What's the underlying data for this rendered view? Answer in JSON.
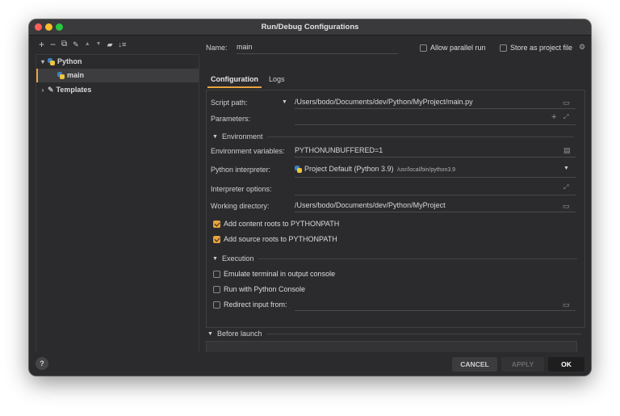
{
  "window": {
    "title": "Run/Debug Configurations",
    "traffic_lights": [
      "#fe5f57",
      "#febc2e",
      "#28c840"
    ]
  },
  "toolbar": {
    "icons": [
      {
        "name": "add-icon",
        "glyph": "+"
      },
      {
        "name": "remove-icon",
        "glyph": "−"
      },
      {
        "name": "copy-icon",
        "glyph": "⧉"
      },
      {
        "name": "wrench-icon",
        "glyph": "🔧"
      },
      {
        "name": "move-up-icon",
        "glyph": "▲"
      },
      {
        "name": "move-down-icon",
        "glyph": "▼"
      },
      {
        "name": "folder-add-icon",
        "glyph": "▰"
      },
      {
        "name": "sort-icon",
        "glyph": "↓"
      }
    ]
  },
  "tree": {
    "python": "Python",
    "main": "main",
    "templates": "Templates"
  },
  "header": {
    "name_label": "Name:",
    "name_value": "main",
    "allow_parallel": "Allow parallel run",
    "store_as_project": "Store as project file"
  },
  "tabs": {
    "configuration": "Configuration",
    "logs": "Logs"
  },
  "form": {
    "script_path_label": "Script path:",
    "script_path_value": "/Users/bodo/Documents/dev/Python/MyProject/main.py",
    "parameters_label": "Parameters:",
    "environment_section": "Environment",
    "env_vars_label": "Environment variables:",
    "env_vars_value": "PYTHONUNBUFFERED=1",
    "interpreter_label": "Python interpreter:",
    "interpreter_value": "Project Default (Python 3.9)",
    "interpreter_path": "/usr/local/bin/python3.9",
    "interpreter_options_label": "Interpreter options:",
    "working_dir_label": "Working directory:",
    "working_dir_value": "/Users/bodo/Documents/dev/Python/MyProject",
    "add_content_roots": "Add content roots to PYTHONPATH",
    "add_source_roots": "Add source roots to PYTHONPATH",
    "execution_section": "Execution",
    "emulate_terminal": "Emulate terminal in output console",
    "run_with_console": "Run with Python Console",
    "redirect_input": "Redirect input from:",
    "before_launch_section": "Before launch"
  },
  "footer": {
    "help": "?",
    "cancel": "CANCEL",
    "apply": "APPLY",
    "ok": "OK"
  },
  "colors": {
    "accent": "#e8a33d",
    "background": "#2b2b2d"
  }
}
